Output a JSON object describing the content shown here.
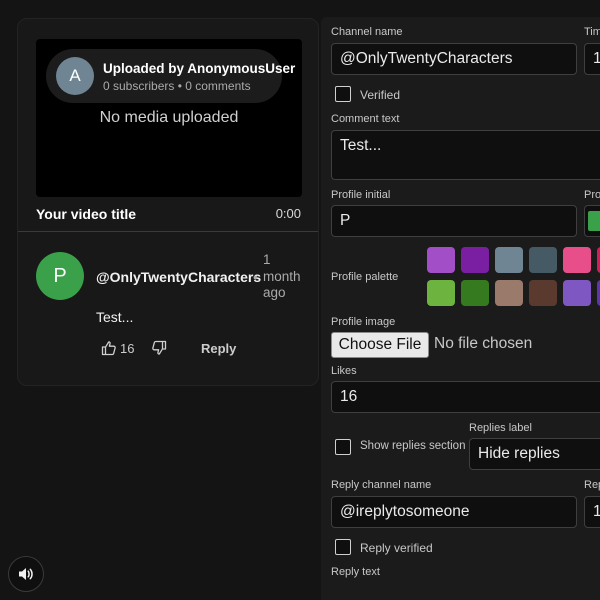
{
  "preview": {
    "uploader_initial": "A",
    "uploader_name": "Uploaded by AnonymousUser",
    "uploader_meta": "0 subscribers • 0 comments",
    "no_media": "No media uploaded",
    "video_title": "Your video title",
    "video_duration": "0:00",
    "comment": {
      "initial": "P",
      "author": "@OnlyTwentyCharacters",
      "separator": "•",
      "time": "1 month ago",
      "text": "Test...",
      "likes": "16",
      "reply_label": "Reply"
    },
    "avatar_color": "#3aa14a",
    "uploader_avatar_color": "#6f8594"
  },
  "sound_icon": "speaker-icon",
  "form": {
    "channel_name_label": "Channel name",
    "channel_name_value": "@OnlyTwentyCharacters",
    "time_label": "Tim",
    "time_value": "1",
    "verified_label": "Verified",
    "comment_text_label": "Comment text",
    "comment_text_value": "Test...",
    "profile_initial_label": "Profile initial",
    "profile_initial_value": "P",
    "profile_color_label": "Pro",
    "profile_palette_label": "Profile palette",
    "palette": [
      "#a24fc7",
      "#7b1fa2",
      "#6f8594",
      "#455a64",
      "#e84f8a",
      "#d81b60",
      "#6db33f",
      "#357a1f",
      "#9a7a6a",
      "#5a3a2e",
      "#7e57c2",
      "#5e35b1"
    ],
    "profile_image_label": "Profile image",
    "choose_file_label": "Choose File",
    "no_file_label": "No file chosen",
    "likes_label": "Likes",
    "likes_value": "16",
    "show_replies_label": "Show replies section",
    "replies_label_label": "Replies label",
    "replies_label_value": "Hide replies",
    "reply_channel_label": "Reply channel name",
    "reply_channel_value": "@ireplytosomeone",
    "reply_time_label": "Rep",
    "reply_time_value": "1",
    "reply_verified_label": "Reply verified",
    "reply_text_label": "Reply text"
  }
}
